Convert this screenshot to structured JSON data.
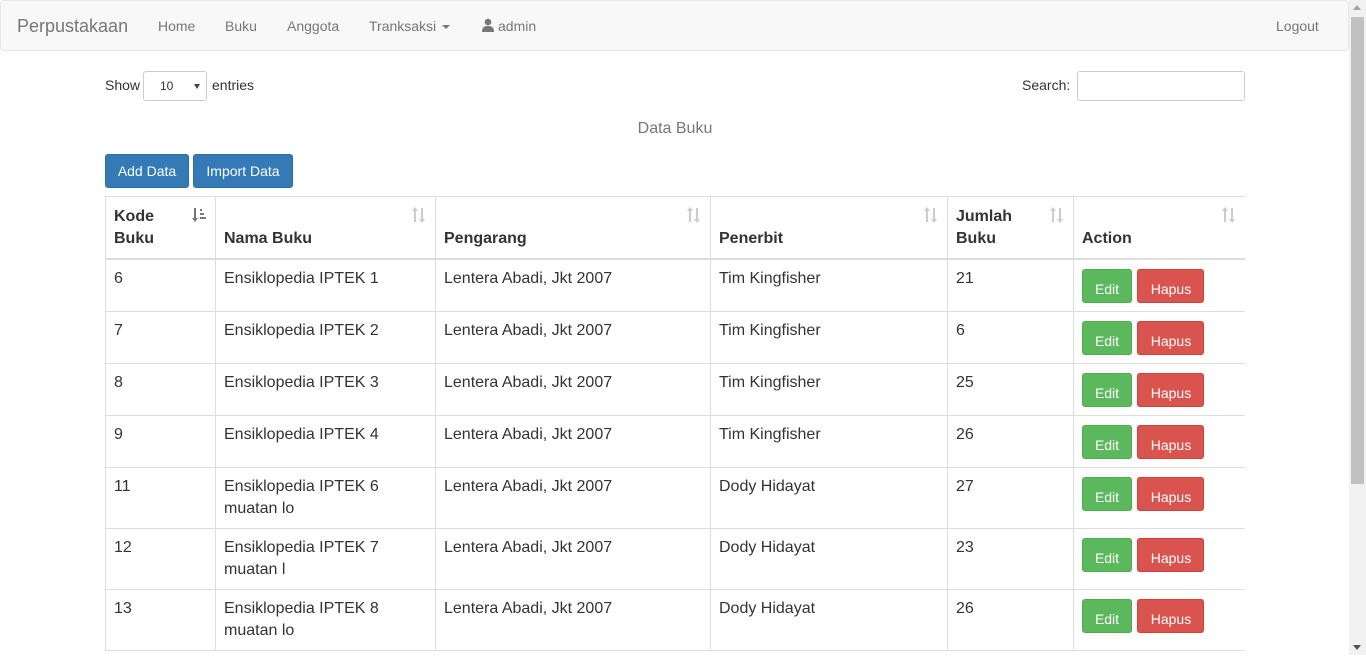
{
  "navbar": {
    "brand": "Perpustakaan",
    "items": [
      {
        "label": "Home"
      },
      {
        "label": "Buku"
      },
      {
        "label": "Anggota"
      },
      {
        "label": "Tranksaksi"
      }
    ],
    "user": "admin",
    "logout": "Logout",
    "icons": {
      "user": "user-icon",
      "dropdown": "caret-down-icon"
    }
  },
  "controls": {
    "show_label": "Show",
    "page_size": "10",
    "entries_label": "entries",
    "search_label": "Search:",
    "search_value": ""
  },
  "table_caption": "Data Buku",
  "buttons": {
    "add": "Add Data",
    "import": "Import Data"
  },
  "table": {
    "headers": [
      "Kode Buku",
      "Nama Buku",
      "Pengarang",
      "Penerbit",
      "Jumlah Buku",
      "Action"
    ],
    "sorted_column": "Kode Buku",
    "rows": [
      {
        "kode": "6",
        "nama": "Ensiklopedia IPTEK 1",
        "pengarang": "Lentera Abadi, Jkt 2007",
        "penerbit": "Tim Kingfisher",
        "jumlah": "21"
      },
      {
        "kode": "7",
        "nama": "Ensiklopedia IPTEK 2",
        "pengarang": "Lentera Abadi, Jkt 2007",
        "penerbit": "Tim Kingfisher",
        "jumlah": "6"
      },
      {
        "kode": "8",
        "nama": "Ensiklopedia IPTEK 3",
        "pengarang": "Lentera Abadi, Jkt 2007",
        "penerbit": "Tim Kingfisher",
        "jumlah": "25"
      },
      {
        "kode": "9",
        "nama": "Ensiklopedia IPTEK 4",
        "pengarang": "Lentera Abadi, Jkt 2007",
        "penerbit": "Tim Kingfisher",
        "jumlah": "26"
      },
      {
        "kode": "11",
        "nama": "Ensiklopedia IPTEK 6 muatan lo",
        "pengarang": "Lentera Abadi, Jkt 2007",
        "penerbit": "Dody Hidayat",
        "jumlah": "27"
      },
      {
        "kode": "12",
        "nama": "Ensiklopedia IPTEK 7 muatan l",
        "pengarang": "Lentera Abadi, Jkt 2007",
        "penerbit": "Dody Hidayat",
        "jumlah": "23"
      },
      {
        "kode": "13",
        "nama": "Ensiklopedia IPTEK 8 muatan lo",
        "pengarang": "Lentera Abadi, Jkt 2007",
        "penerbit": "Dody Hidayat",
        "jumlah": "26"
      }
    ],
    "edit_label": "Edit",
    "delete_label": "Hapus"
  },
  "colors": {
    "primary": "#337ab7",
    "success": "#5cb85c",
    "danger": "#d9534f",
    "navbar_bg": "#f8f8f8"
  }
}
